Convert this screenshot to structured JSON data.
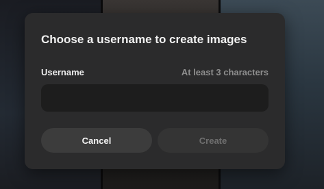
{
  "dialog": {
    "title": "Choose a username to create images",
    "username": {
      "label": "Username",
      "hint": "At least 3 characters",
      "value": "",
      "placeholder": ""
    },
    "cancel_label": "Cancel",
    "create_label": "Create",
    "create_disabled": true
  },
  "colors": {
    "dialog_bg": "#2b2b2c",
    "input_bg": "#1d1d1d",
    "cancel_bg": "#3c3c3c",
    "create_bg_disabled": "#343434",
    "hint_text": "#8e8e8e"
  }
}
